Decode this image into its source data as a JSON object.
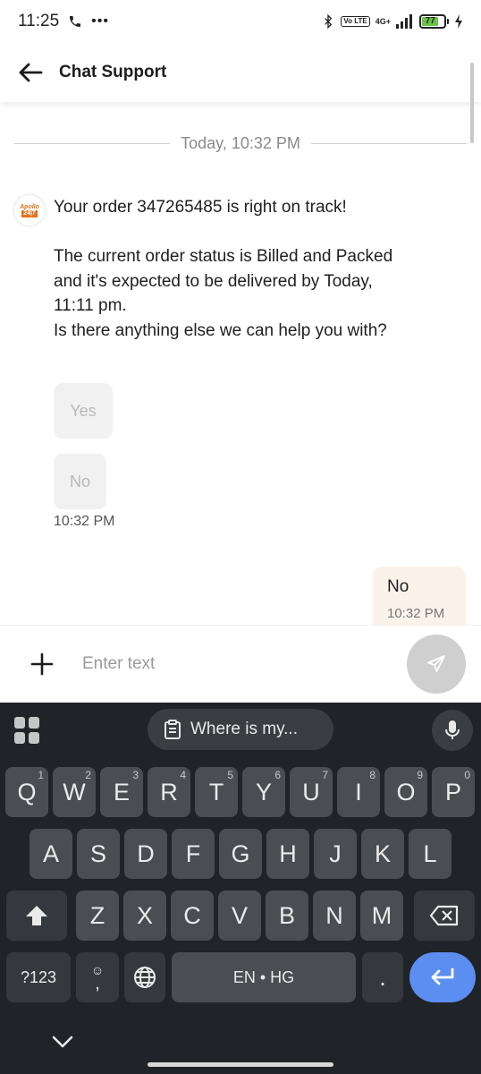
{
  "status_bar": {
    "time": "11:25",
    "volte": "Vo LTE",
    "network": "4G+",
    "battery": "77"
  },
  "header": {
    "title": "Chat Support"
  },
  "chat": {
    "date_separator": "Today, 10:32 PM",
    "bot_avatar_text": [
      "Apollo",
      "24|7"
    ],
    "bot_message": {
      "line1": "Your order 347265485 is right on track!",
      "line2": "The current order status is Billed and Packed and it's expected to be delivered by Today, 11:11 pm.",
      "line3": "Is there anything else we can help you with?"
    },
    "quick_replies": [
      "Yes",
      "No"
    ],
    "bot_time": "10:32 PM",
    "user_message": {
      "text": "No",
      "time": "10:32 PM"
    }
  },
  "input": {
    "placeholder": "Enter text"
  },
  "keyboard": {
    "suggestion": "Where is my...",
    "row1": [
      {
        "k": "Q",
        "h": "1"
      },
      {
        "k": "W",
        "h": "2"
      },
      {
        "k": "E",
        "h": "3"
      },
      {
        "k": "R",
        "h": "4"
      },
      {
        "k": "T",
        "h": "5"
      },
      {
        "k": "Y",
        "h": "6"
      },
      {
        "k": "U",
        "h": "7"
      },
      {
        "k": "I",
        "h": "8"
      },
      {
        "k": "O",
        "h": "9"
      },
      {
        "k": "P",
        "h": "0"
      }
    ],
    "row2": [
      "A",
      "S",
      "D",
      "F",
      "G",
      "H",
      "J",
      "K",
      "L"
    ],
    "row3": [
      "Z",
      "X",
      "C",
      "V",
      "B",
      "N",
      "M"
    ],
    "symbols_label": "?123",
    "emoji_comma": ",",
    "space_label": "EN • HG",
    "period": "."
  },
  "colors": {
    "accent_orange": "#e5701d",
    "user_bubble": "#fbf3ea",
    "keyboard_bg": "#202328",
    "enter_key": "#5b8ef0"
  }
}
